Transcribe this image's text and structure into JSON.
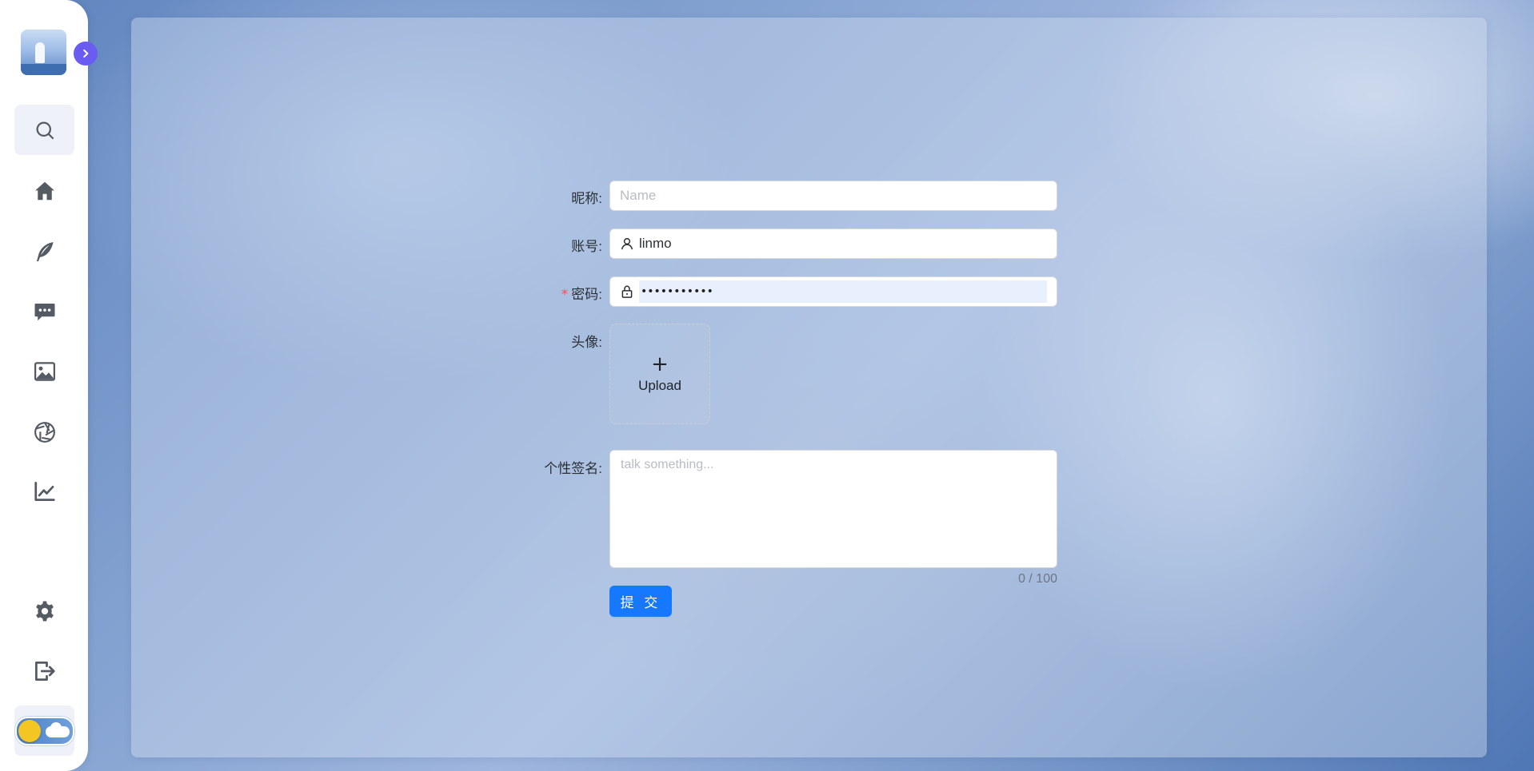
{
  "sidebar": {
    "avatar_alt": "",
    "expand_icon": "chevron-right-icon",
    "items": [
      {
        "name": "search",
        "icon": "search-icon",
        "active": true
      },
      {
        "name": "home",
        "icon": "home-icon",
        "active": false
      },
      {
        "name": "write",
        "icon": "feather-icon",
        "active": false
      },
      {
        "name": "messages",
        "icon": "chat-icon",
        "active": false
      },
      {
        "name": "gallery",
        "icon": "image-icon",
        "active": false
      },
      {
        "name": "camera",
        "icon": "aperture-icon",
        "active": false
      },
      {
        "name": "stats",
        "icon": "chart-line-icon",
        "active": false
      },
      {
        "name": "settings",
        "icon": "gear-icon",
        "active": false
      },
      {
        "name": "logout",
        "icon": "logout-icon",
        "active": false
      }
    ],
    "theme_toggle": {
      "state": "light"
    }
  },
  "form": {
    "nickname": {
      "label": "昵称:",
      "placeholder": "Name",
      "value": ""
    },
    "account": {
      "label": "账号:",
      "value": "linmo"
    },
    "password": {
      "label": "密码:",
      "required_mark": "*",
      "masked_value": "•••••••••••"
    },
    "avatar": {
      "label": "头像:",
      "plus": "+",
      "upload_text": "Upload"
    },
    "signature": {
      "label": "个性签名:",
      "placeholder": "talk something...",
      "counter": "0 / 100"
    },
    "submit_label": "提 交"
  },
  "colors": {
    "primary": "#1677ff",
    "required": "#ff4d4f",
    "toggle_knob": "#f3c623",
    "expand_button": "#6a5cf0"
  }
}
